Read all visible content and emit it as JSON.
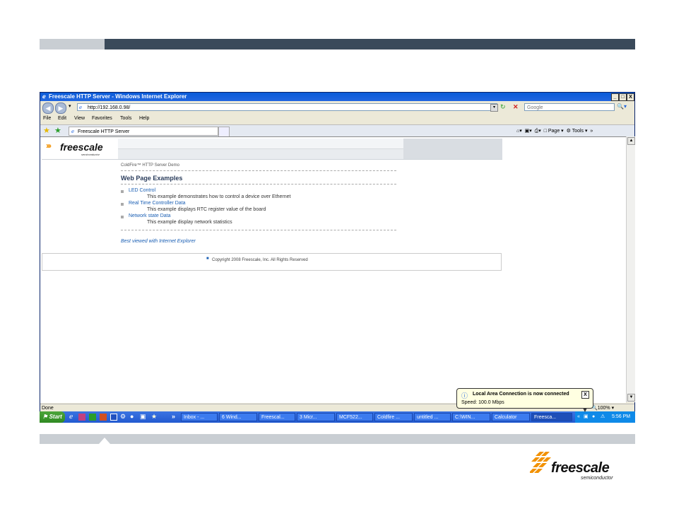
{
  "window": {
    "title": "Freescale HTTP Server - Windows Internet Explorer",
    "controls": [
      "_",
      "□",
      "X"
    ]
  },
  "address": {
    "url": "http://192.168.0.98/",
    "search_placeholder": "Google"
  },
  "menu": [
    "File",
    "Edit",
    "View",
    "Favorites",
    "Tools",
    "Help"
  ],
  "tab": {
    "label": "Freescale HTTP Server"
  },
  "toolbar_right": {
    "page": "Page",
    "tools": "Tools"
  },
  "page": {
    "logo_word": "freescale",
    "logo_sub": "semiconductor",
    "breadcrumb": "ColdFire™ HTTP Server Demo",
    "title": "Web Page Examples",
    "examples": [
      {
        "link": "LED Control",
        "desc": "This example demonstrates how to control a device over Ethernet"
      },
      {
        "link": "Real Time Controller Data",
        "desc": "This example displays RTC register value of the board"
      },
      {
        "link": "Network state Data",
        "desc": "This example display network statistics"
      }
    ],
    "best_viewed": "Best viewed with Internet Explorer",
    "copyright": "Copyright 2008 Freescale, Inc. All Rights Reserved"
  },
  "status": {
    "text": "Done",
    "zoom": "100%"
  },
  "balloon": {
    "title": "Local Area Connection is now connected",
    "body": "Speed: 100.0 Mbps",
    "close": "X"
  },
  "taskbar": {
    "start": "Start",
    "items": [
      "Inbox - ...",
      "6 Wind...",
      "Freescal...",
      "3 Micr...",
      "MCF522...",
      "Coldfire ...",
      "untitled ...",
      "C:\\WIN...",
      "Calculator",
      "Freesca..."
    ],
    "clock": "5:56 PM"
  },
  "slide_logo": {
    "word": "freescale",
    "sub": "semiconductor"
  },
  "colors": {
    "accent_orange": "#f29100",
    "xp_blue": "#225ad0",
    "slide_dark": "#3a4a5a"
  }
}
